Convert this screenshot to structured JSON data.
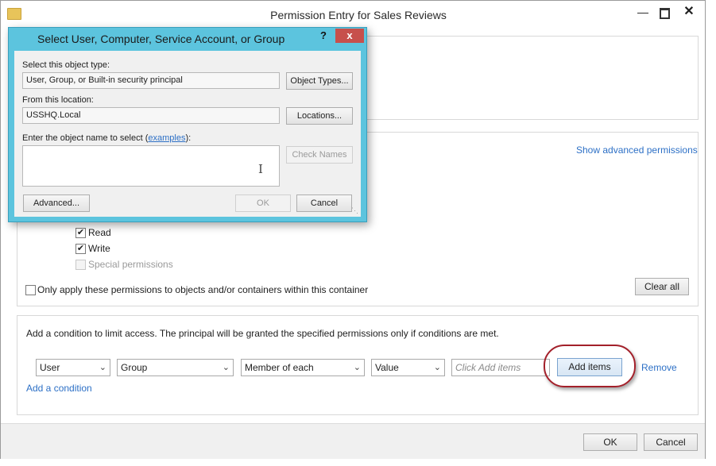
{
  "main_window": {
    "title": "Permission Entry for Sales Reviews",
    "show_advanced": "Show advanced permissions",
    "permissions": [
      {
        "label": "Read",
        "checked": true,
        "enabled": true
      },
      {
        "label": "Write",
        "checked": true,
        "enabled": true
      },
      {
        "label": "Special permissions",
        "checked": false,
        "enabled": false
      }
    ],
    "only_apply_label": "Only apply these permissions to objects and/or containers within this container",
    "clear_all": "Clear all",
    "condition_text": "Add a condition to limit access. The principal will be granted the specified permissions only if conditions are met.",
    "condition": {
      "attribute_type": "User",
      "attribute": "Group",
      "operator": "Member of each",
      "value_type": "Value",
      "value_placeholder": "Click Add items",
      "add_items": "Add items",
      "remove": "Remove"
    },
    "add_condition": "Add a condition",
    "ok": "OK",
    "cancel": "Cancel",
    "accent_color": "#2d70c6",
    "highlight_color": "#a3202a"
  },
  "dialog": {
    "title": "Select User, Computer, Service Account, or Group",
    "help_glyph": "?",
    "close_glyph": "x",
    "object_type_label": "Select this object type:",
    "object_type_value": "User, Group, or Built-in security principal",
    "object_types_button": "Object Types...",
    "location_label": "From this location:",
    "location_value": "USSHQ.Local",
    "locations_button": "Locations...",
    "enter_label_prefix": "Enter the object name to select (",
    "enter_label_link": "examples",
    "enter_label_suffix": "):",
    "check_names": "Check Names",
    "advanced": "Advanced...",
    "ok": "OK",
    "cancel": "Cancel",
    "frame_color": "#5cc4de"
  }
}
